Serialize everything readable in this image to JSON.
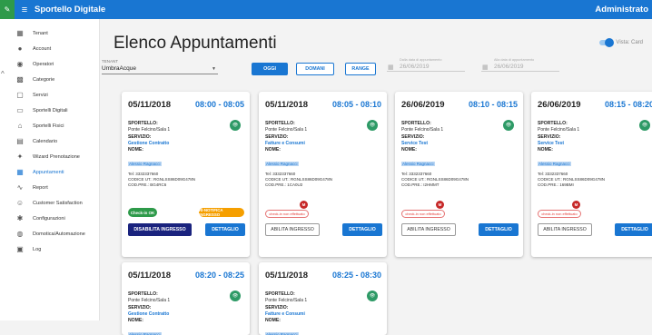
{
  "header": {
    "title": "Sportello Digitale",
    "user": "Administrato"
  },
  "sidebar": {
    "items": [
      {
        "label": "Tenant",
        "icon": "building-icon",
        "glyph": "▦"
      },
      {
        "label": "Account",
        "icon": "person-icon",
        "glyph": "●"
      },
      {
        "label": "Operatori",
        "icon": "account-circle-icon",
        "glyph": "◉"
      },
      {
        "label": "Categorie",
        "icon": "grid-icon",
        "glyph": "▩"
      },
      {
        "label": "Servizi",
        "icon": "document-icon",
        "glyph": "▢"
      },
      {
        "label": "Sportelli Digitali",
        "icon": "monitor-icon",
        "glyph": "▭"
      },
      {
        "label": "Sportelli Fisici",
        "icon": "home-icon",
        "glyph": "⌂"
      },
      {
        "label": "Calendario",
        "icon": "calendar-icon",
        "glyph": "▤"
      },
      {
        "label": "Wizard Prenotazione",
        "icon": "magic-wand-icon",
        "glyph": "✦"
      },
      {
        "label": "Appuntamenti",
        "icon": "list-icon",
        "glyph": "▦",
        "active": true
      },
      {
        "label": "Report",
        "icon": "chart-line-icon",
        "glyph": "∿"
      },
      {
        "label": "Customer Satisfaction",
        "icon": "smiley-icon",
        "glyph": "☺"
      },
      {
        "label": "Configurazioni",
        "icon": "gear-icon",
        "glyph": "✱"
      },
      {
        "label": "Domotica/Automazione",
        "icon": "automation-icon",
        "glyph": "◍"
      },
      {
        "label": "Log",
        "icon": "log-icon",
        "glyph": "▣"
      }
    ],
    "active_color": "#1976d2"
  },
  "page": {
    "title": "Elenco Appuntamenti",
    "view_toggle": "Vista: Card"
  },
  "filters": {
    "tenant_label": "TENANT",
    "tenant_value": "UmbraAcque",
    "btn_today": "OGGI",
    "btn_tomorrow": "DOMANI",
    "btn_range": "RANGE",
    "from_label": "Dalla data di appuntamento",
    "from_value": "26/06/2019",
    "to_label": "Alla data di appuntamento",
    "to_value": "26/06/2019"
  },
  "labels": {
    "sportello": "SPORTELLO:",
    "servizio": "SERVIZIO:",
    "nome": "NOME:",
    "check_in_missing": "check-in non effettuato",
    "abilita": "ABILITA INGRESSO",
    "disabilita": "DISABILITA INGRESSO",
    "dettaglio": "DETTAGLIO",
    "check_in_ok": "Check-in OK",
    "re_notifica": "RI-NOTIFICA INGRESSO",
    "m_badge": "M"
  },
  "cards": [
    {
      "date": "05/11/2018",
      "time": "08:00 - 08:05",
      "sportello": "Ponte Felcino/Sala 1",
      "servizio": "Gestione Contratto",
      "nome": "Alessio Ragnacci",
      "tel": "Tel: 3332337660",
      "cf": "CODICE UT.: RGNLSS86D09G478N",
      "cod": "COD.PRE.: BG4RC6",
      "status": "ok"
    },
    {
      "date": "05/11/2018",
      "time": "08:05 - 08:10",
      "sportello": "Ponte Felcino/Sala 1",
      "servizio": "Fatture e Consumi",
      "nome": "Alessio Ragnacci",
      "tel": "Tel: 3332337660",
      "cf": "CODICE UT.: RGNLSS86D09G478N",
      "cod": "COD.PRE.: 1CA0U2",
      "status": "pending"
    },
    {
      "date": "26/06/2019",
      "time": "08:10 - 08:15",
      "sportello": "Ponte Felcino/Sala 1",
      "servizio": "Service Test",
      "nome": "Alessio Ragnacci",
      "tel": "Tel: 3332337660",
      "cf": "CODICE UT.: RGNLSS86D09G478N",
      "cod": "COD.PRE.: I2HMMT",
      "status": "pending"
    },
    {
      "date": "26/06/2019",
      "time": "08:15 - 08:20",
      "sportello": "Ponte Felcino/Sala 1",
      "servizio": "Service Test",
      "nome": "Alessio Ragnacci",
      "tel": "Tel: 3332337660",
      "cf": "CODICE UT.: RGNLSS86D09G478N",
      "cod": "COD.PRE.: 169BMI",
      "status": "pending"
    },
    {
      "date": "05/11/2018",
      "time": "08:20 - 08:25",
      "sportello": "Ponte Felcino/Sala 1",
      "servizio": "Gestione Contratto",
      "nome": "Alessio Ragnacci"
    },
    {
      "date": "05/11/2018",
      "time": "08:25 - 08:30",
      "sportello": "Ponte Felcino/Sala 1",
      "servizio": "Fatture e Consumi",
      "nome": "Alessio Ragnacci"
    }
  ],
  "colors": {
    "primary": "#1976d2",
    "fab": "#2e9a66",
    "danger": "#c62828",
    "ok": "#2e9a4a",
    "warn": "#f59f00",
    "dark": "#1a237e"
  }
}
